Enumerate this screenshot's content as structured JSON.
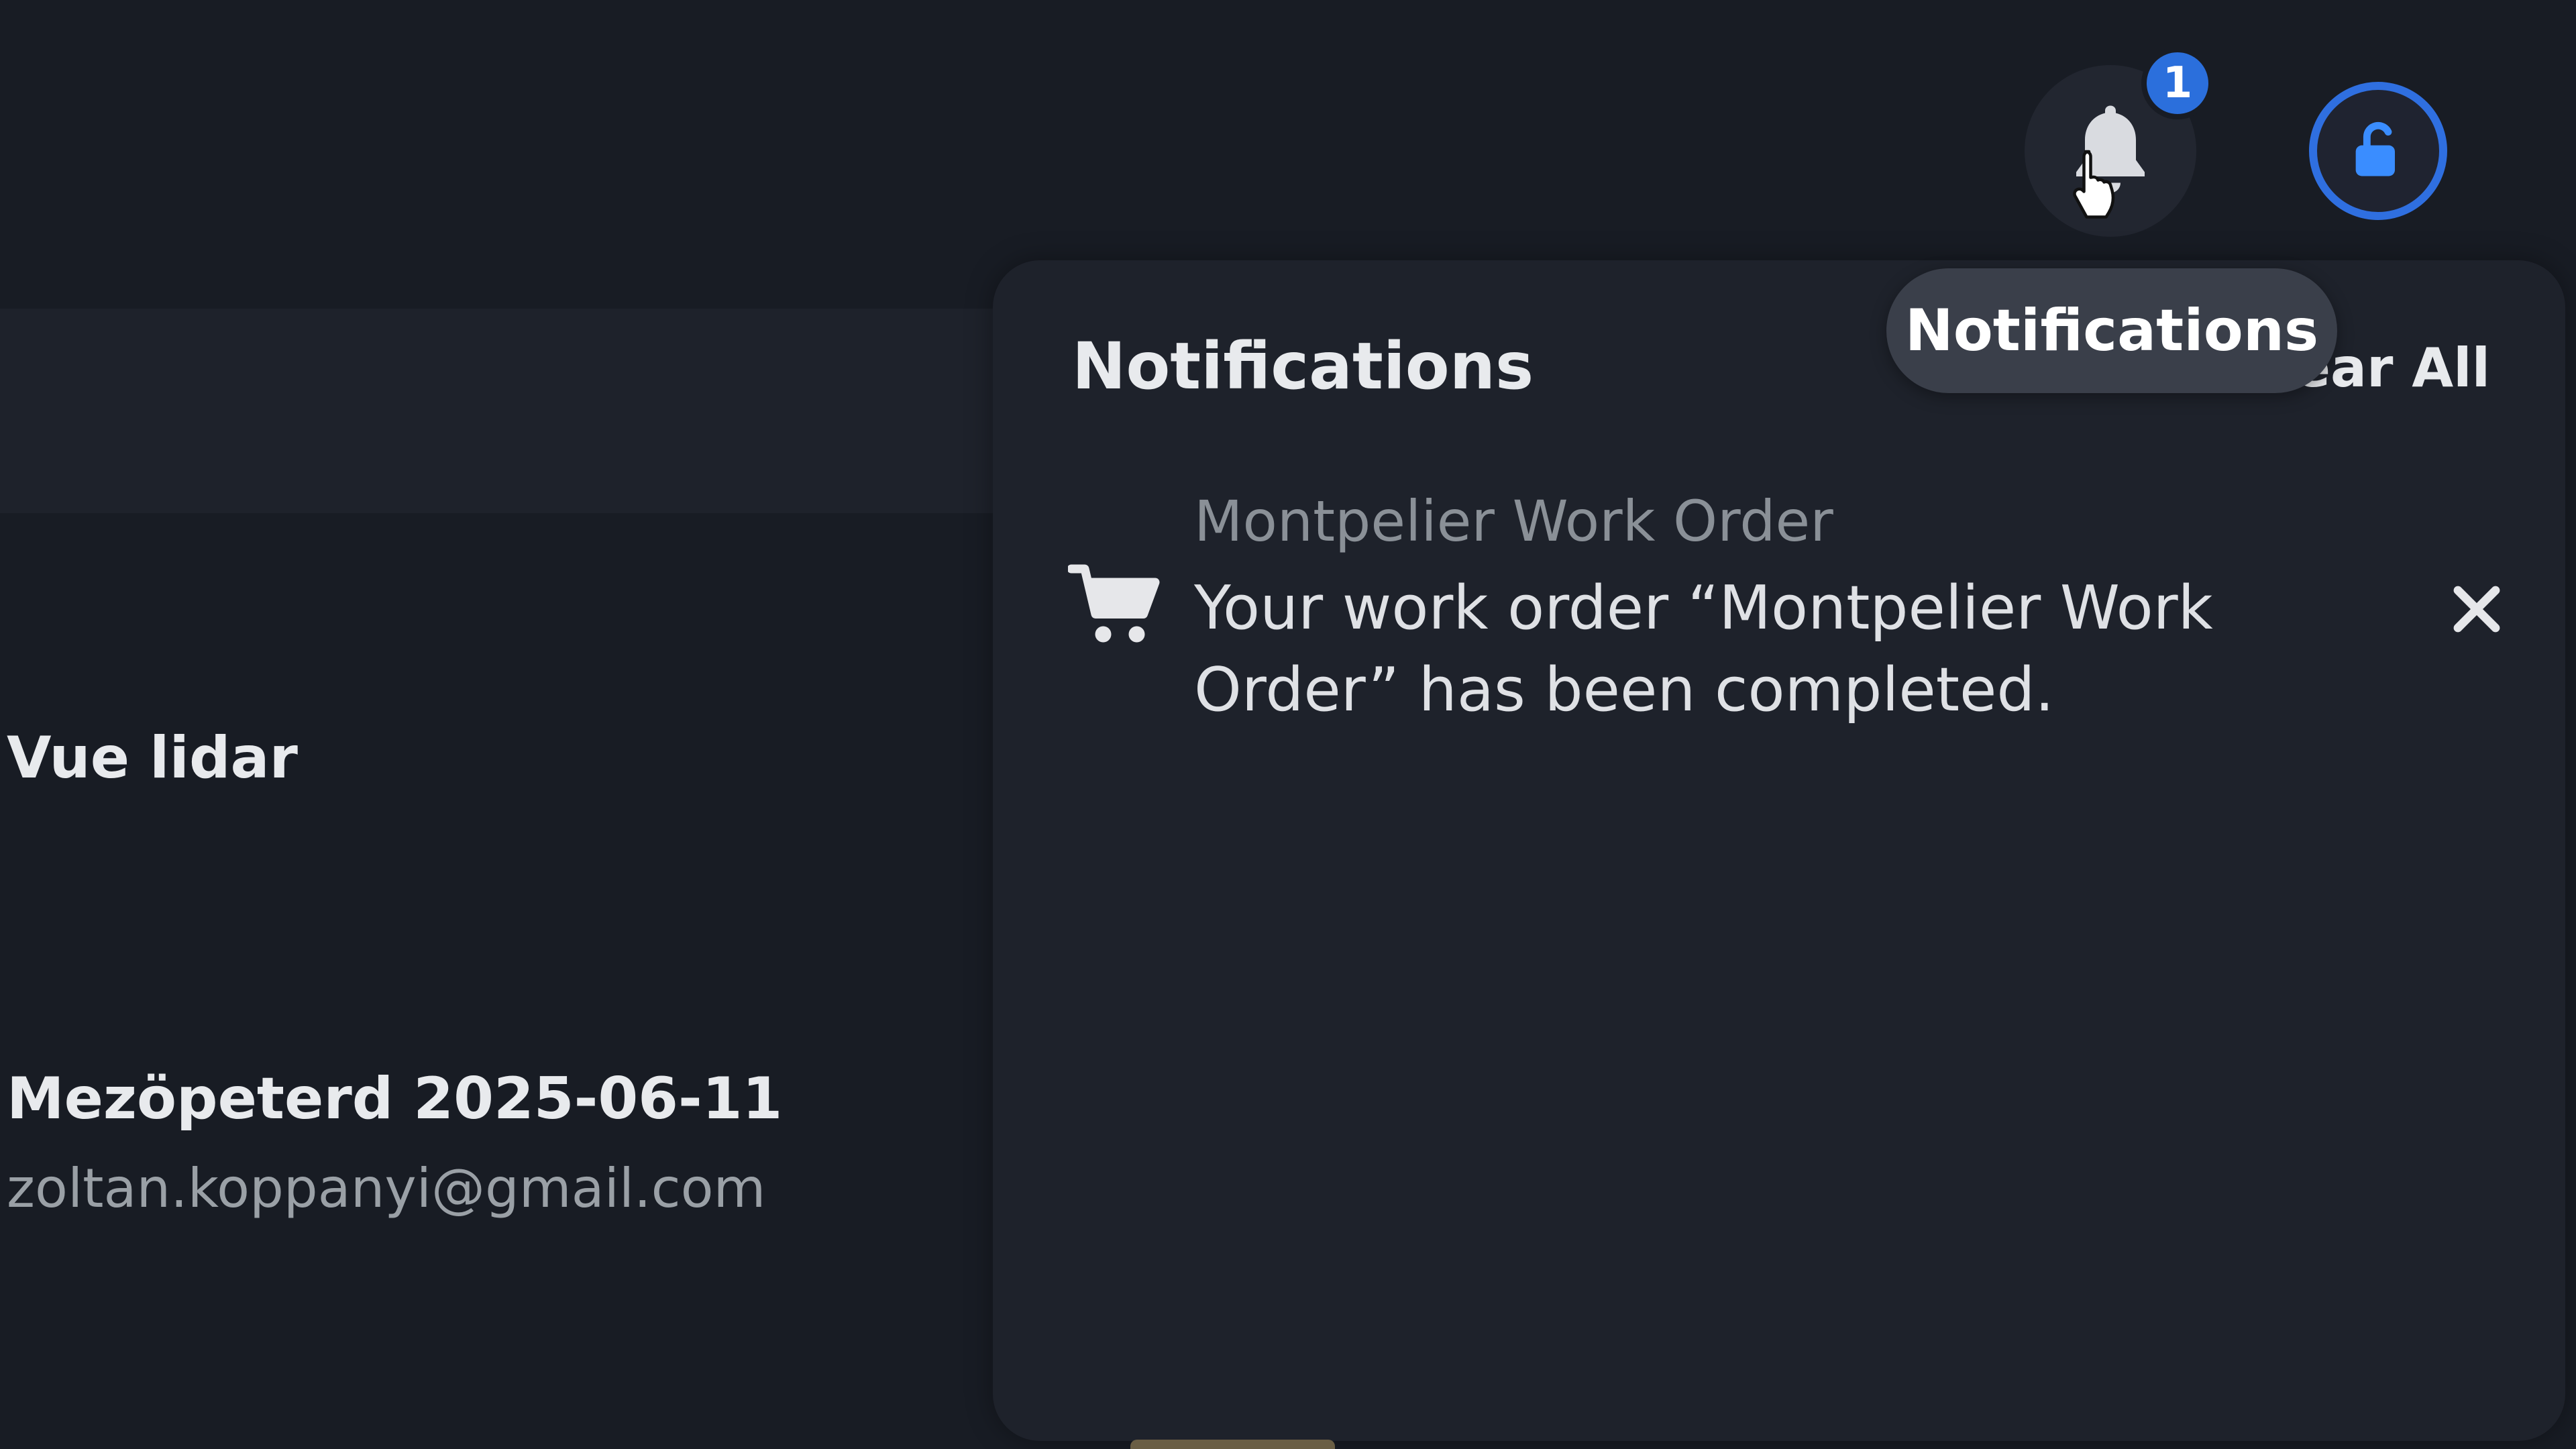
{
  "header": {
    "notifications_badge": "1",
    "tooltip": "Notifications",
    "icons": {
      "bell": "bell-icon",
      "avatar": "unlock-icon",
      "cursor": "hand-pointer-icon"
    }
  },
  "list": {
    "items": [
      {
        "title": "Vue lidar"
      },
      {
        "title": "Mezöpeterd 2025-06-11",
        "subtitle": "zoltan.koppanyi@gmail.com"
      }
    ]
  },
  "notifications_panel": {
    "title": "Notifications",
    "clear_all_label": "Clear All",
    "items": [
      {
        "icon": "cart-icon",
        "heading": "Montpelier Work Order",
        "message": "Your work order “Montpelier Work Order” has been completed."
      }
    ]
  },
  "colors": {
    "background": "#181c24",
    "panel": "#1e222b",
    "accent": "#2f6fe0",
    "badge": "#2b6fdc"
  }
}
